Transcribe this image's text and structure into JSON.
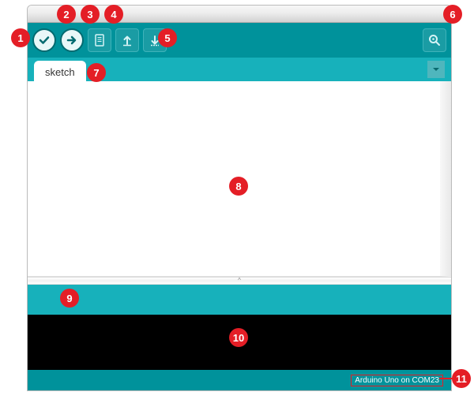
{
  "tab": {
    "label": "sketch"
  },
  "footer": {
    "board": "Arduino Uno on COM23"
  },
  "icons": {
    "verify": "verify-icon",
    "upload": "upload-icon",
    "new": "new-icon",
    "open": "open-icon",
    "save": "save-icon",
    "serial": "serial-monitor-icon",
    "tabmenu": "tab-dropdown-icon"
  },
  "annotations": {
    "1": "1",
    "2": "2",
    "3": "3",
    "4": "4",
    "5": "5",
    "6": "6",
    "7": "7",
    "8": "8",
    "9": "9",
    "10": "10",
    "11": "11"
  }
}
